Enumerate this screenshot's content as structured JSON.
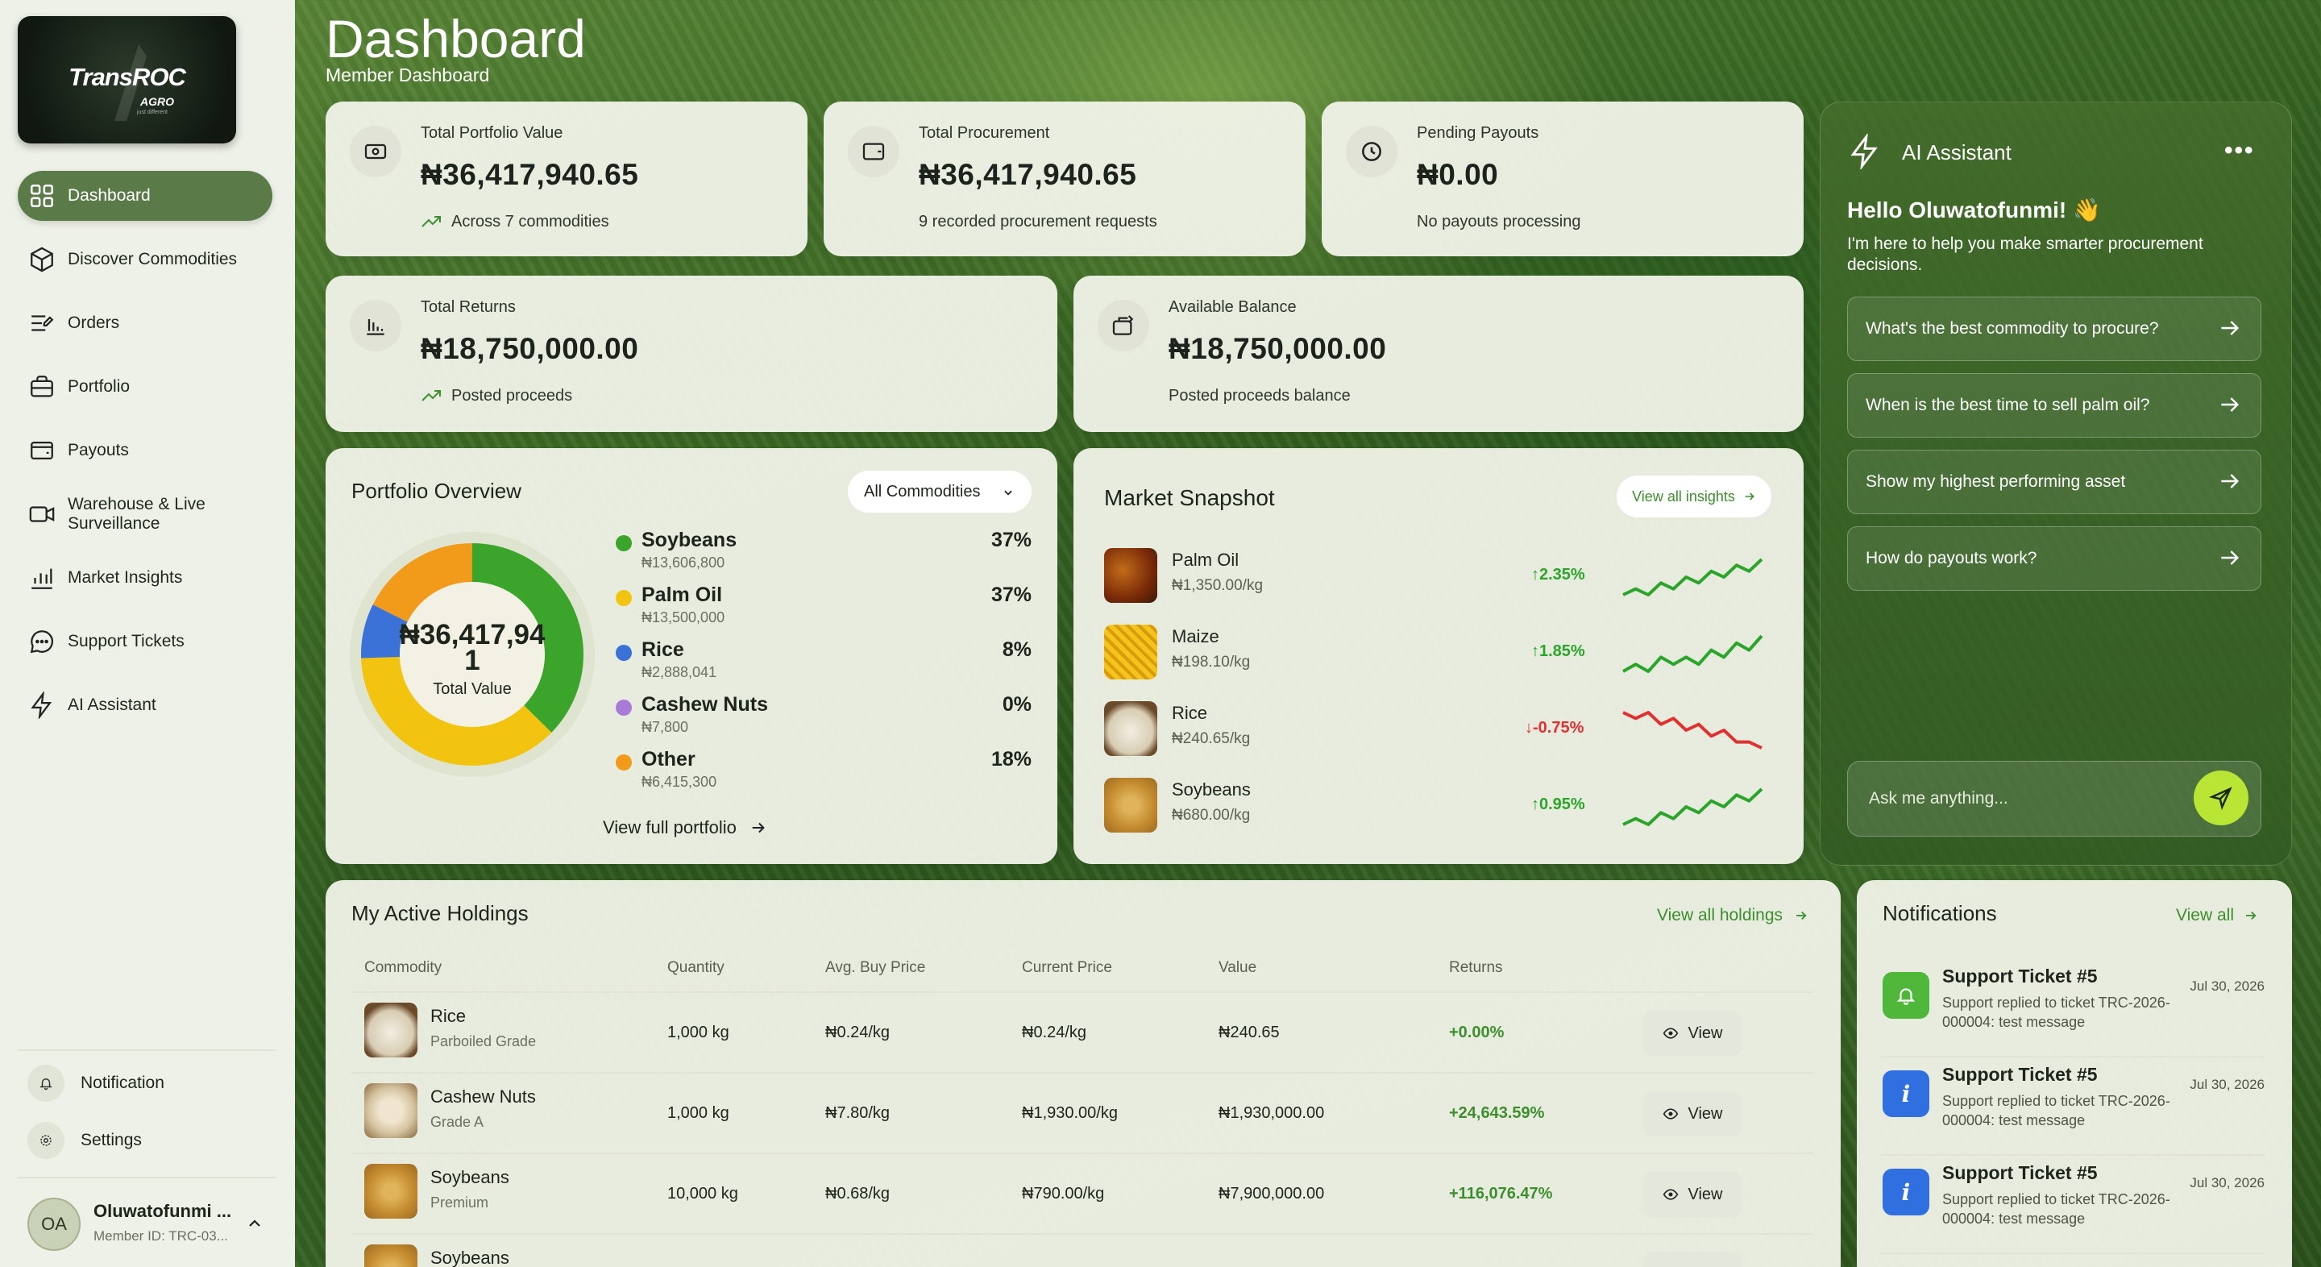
{
  "brand": {
    "logo_text": "TransROC",
    "logo_sub": "AGRO",
    "logo_tagline": "just different"
  },
  "sidebar": {
    "items": [
      {
        "label": "Dashboard",
        "icon": "grid-icon"
      },
      {
        "label": "Discover Commodities",
        "icon": "box-icon"
      },
      {
        "label": "Orders",
        "icon": "orders-icon"
      },
      {
        "label": "Portfolio",
        "icon": "briefcase-icon"
      },
      {
        "label": "Payouts",
        "icon": "wallet-icon"
      },
      {
        "label": "Warehouse & Live Surveillance",
        "icon": "video-icon"
      },
      {
        "label": "Market Insights",
        "icon": "bar-chart-icon"
      },
      {
        "label": "Support Tickets",
        "icon": "chat-icon"
      },
      {
        "label": "AI Assistant",
        "icon": "lightning-icon"
      }
    ],
    "bottom": [
      {
        "label": "Notification",
        "icon": "bell-icon"
      },
      {
        "label": "Settings",
        "icon": "gear-icon"
      }
    ],
    "user": {
      "initials": "OA",
      "name": "Oluwatofunmi ...",
      "member_id": "Member ID: TRC-03..."
    }
  },
  "header": {
    "title": "Dashboard",
    "subtitle": "Member Dashboard"
  },
  "stats": {
    "portfolio": {
      "label": "Total Portfolio Value",
      "value": "₦36,417,940.65",
      "note": "Across 7 commodities"
    },
    "procurement": {
      "label": "Total Procurement",
      "value": "₦36,417,940.65",
      "note": "9 recorded procurement requests"
    },
    "pending": {
      "label": "Pending Payouts",
      "value": "₦0.00",
      "note": "No payouts processing"
    },
    "returns": {
      "label": "Total Returns",
      "value": "₦18,750,000.00",
      "note": "Posted proceeds"
    },
    "balance": {
      "label": "Available Balance",
      "value": "₦18,750,000.00",
      "note": "Posted proceeds balance"
    }
  },
  "portfolio_overview": {
    "title": "Portfolio Overview",
    "filter": "All Commodities",
    "center_value": "₦36,417,941",
    "center_label": "Total Value",
    "link": "View full portfolio",
    "items": [
      {
        "name": "Soybeans",
        "value": "₦13,606,800",
        "pct": "37%",
        "color": "#3aa52a"
      },
      {
        "name": "Palm Oil",
        "value": "₦13,500,000",
        "pct": "37%",
        "color": "#f2c40f"
      },
      {
        "name": "Rice",
        "value": "₦2,888,041",
        "pct": "8%",
        "color": "#3a72d8"
      },
      {
        "name": "Cashew Nuts",
        "value": "₦7,800",
        "pct": "0%",
        "color": "#a77bd6"
      },
      {
        "name": "Other",
        "value": "₦6,415,300",
        "pct": "18%",
        "color": "#f29a1a"
      }
    ]
  },
  "chart_data": {
    "type": "pie",
    "categories": [
      "Soybeans",
      "Palm Oil",
      "Rice",
      "Cashew Nuts",
      "Other"
    ],
    "values": [
      13606800,
      13500000,
      2888041,
      7800,
      6415300
    ],
    "title": "Portfolio Overview"
  },
  "market": {
    "title": "Market Snapshot",
    "link": "View all insights",
    "items": [
      {
        "name": "Palm Oil",
        "price": "₦1,350.00/kg",
        "change": "2.35%",
        "dir": "up",
        "trend": [
          5,
          6,
          5,
          7,
          6,
          8,
          7,
          9,
          8,
          10,
          9,
          11
        ]
      },
      {
        "name": "Maize",
        "price": "₦198.10/kg",
        "change": "1.85%",
        "dir": "up",
        "trend": [
          4,
          5,
          4,
          6,
          5,
          6,
          5,
          7,
          6,
          8,
          7,
          9
        ]
      },
      {
        "name": "Rice",
        "price": "₦240.65/kg",
        "change": "-0.75%",
        "dir": "down",
        "trend": [
          10,
          9,
          10,
          8,
          9,
          7,
          8,
          6,
          7,
          5,
          5,
          4
        ]
      },
      {
        "name": "Soybeans",
        "price": "₦680.00/kg",
        "change": "0.95%",
        "dir": "up",
        "trend": [
          4,
          5,
          4,
          6,
          5,
          7,
          6,
          8,
          7,
          9,
          8,
          10
        ]
      }
    ]
  },
  "ai": {
    "title": "AI Assistant",
    "greeting": "Hello Oluwatofunmi! 👋",
    "intro": "I'm here to help you make smarter procurement decisions.",
    "suggestions": [
      "What's the best commodity to procure?",
      "When is the best time to sell palm oil?",
      "Show my highest performing asset",
      "How do payouts work?"
    ],
    "placeholder": "Ask me anything..."
  },
  "holdings": {
    "title": "My Active Holdings",
    "link": "View all holdings",
    "columns": [
      "Commodity",
      "Quantity",
      "Avg. Buy Price",
      "Current Price",
      "Value",
      "Returns"
    ],
    "view_label": "View",
    "rows": [
      {
        "name": "Rice",
        "grade": "Parboiled Grade",
        "qty": "1,000 kg",
        "avg": "₦0.24/kg",
        "cur": "₦0.24/kg",
        "value": "₦240.65",
        "ret": "+0.00%"
      },
      {
        "name": "Cashew Nuts",
        "grade": "Grade A",
        "qty": "1,000 kg",
        "avg": "₦7.80/kg",
        "cur": "₦1,930.00/kg",
        "value": "₦1,930,000.00",
        "ret": "+24,643.59%"
      },
      {
        "name": "Soybeans",
        "grade": "Premium",
        "qty": "10,000 kg",
        "avg": "₦0.68/kg",
        "cur": "₦790.00/kg",
        "value": "₦7,900,000.00",
        "ret": "+116,076.47%"
      },
      {
        "name": "Soybeans",
        "grade": "",
        "qty": "",
        "avg": "",
        "cur": "",
        "value": "",
        "ret": ""
      }
    ]
  },
  "notifications": {
    "title": "Notifications",
    "link": "View all",
    "items": [
      {
        "title": "Support Ticket #5",
        "body": "Support replied to ticket TRC-2026-000004: test message",
        "date": "Jul 30, 2026",
        "kind": "bell"
      },
      {
        "title": "Support Ticket #5",
        "body": "Support replied to ticket TRC-2026-000004: test message",
        "date": "Jul 30, 2026",
        "kind": "info"
      },
      {
        "title": "Support Ticket #5",
        "body": "Support replied to ticket TRC-2026-000004: test message",
        "date": "Jul 30, 2026",
        "kind": "info"
      }
    ]
  }
}
